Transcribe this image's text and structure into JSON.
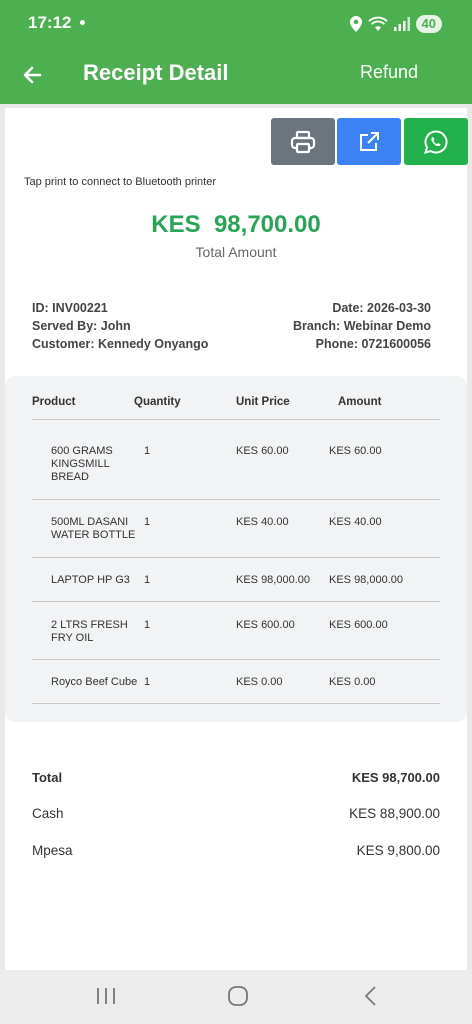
{
  "status_bar": {
    "time": "17:12",
    "battery": "40"
  },
  "app_bar": {
    "title": "Receipt Detail",
    "refund_label": "Refund"
  },
  "hint": "Tap print to connect to Bluetooth printer",
  "summary": {
    "total_amount": "KES  98,700.00",
    "total_label": "Total Amount"
  },
  "meta": {
    "id": "ID: INV00221",
    "served_by": "Served By: John",
    "customer": "Customer: Kennedy Onyango",
    "date": "Date: 2026-03-30",
    "branch": "Branch: Webinar Demo",
    "phone": "Phone: 0721600056"
  },
  "table": {
    "headers": [
      "Product",
      "Quantity",
      "Unit Price",
      "Amount"
    ],
    "rows": [
      {
        "product": "600 GRAMS KINGSMILL BREAD",
        "qty": "1",
        "unit": "KES 60.00",
        "amount": "KES 60.00"
      },
      {
        "product": "500ML DASANI WATER BOTTLE",
        "qty": "1",
        "unit": "KES 40.00",
        "amount": "KES 40.00"
      },
      {
        "product": "LAPTOP HP G3",
        "qty": "1",
        "unit": "KES 98,000.00",
        "amount": "KES 98,000.00"
      },
      {
        "product": "2 LTRS FRESH FRY OIL",
        "qty": "1",
        "unit": "KES 600.00",
        "amount": "KES 600.00"
      },
      {
        "product": "Royco Beef Cube",
        "qty": "1",
        "unit": "KES 0.00",
        "amount": "KES 0.00"
      }
    ]
  },
  "totals": {
    "total_label": "Total",
    "total_value": "KES 98,700.00",
    "cash_label": "Cash",
    "cash_value": "KES 88,900.00",
    "mpesa_label": "Mpesa",
    "mpesa_value": "KES 9,800.00"
  },
  "colors": {
    "brand_green": "#4caf50",
    "amount_green": "#27a553",
    "print_grey": "#6c757d",
    "share_blue": "#3b82f6",
    "whatsapp_green": "#22b14c"
  }
}
